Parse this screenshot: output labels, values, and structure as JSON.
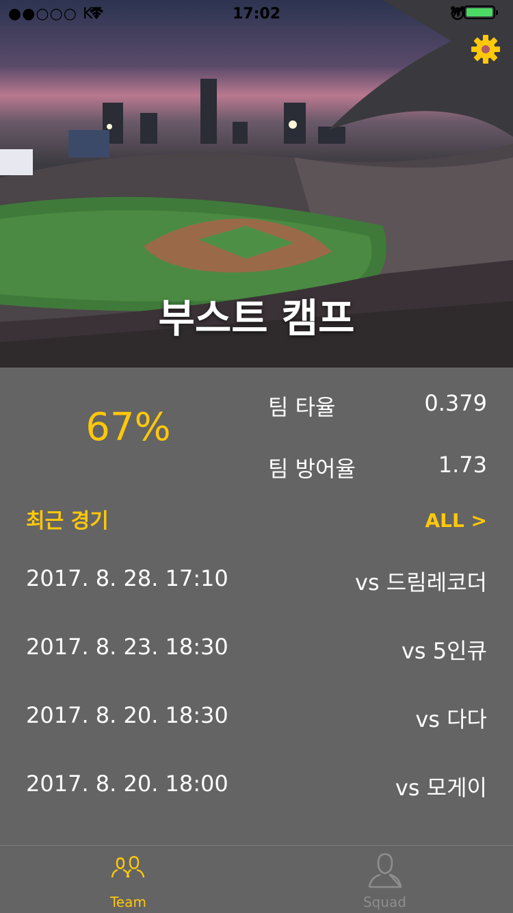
{
  "status_bar": {
    "carrier": "●●○○○ KT",
    "time": "17:02"
  },
  "hero": {
    "team_name": "부스트 캠프"
  },
  "stats": {
    "win_rate": "67%",
    "batting_avg_label": "팀 타율",
    "batting_avg_value": "0.379",
    "era_label": "팀 방어율",
    "era_value": "1.73"
  },
  "recent_games": {
    "title": "최근 경기",
    "all_label": "ALL >",
    "games": [
      {
        "date": "2017. 8. 28. 17:10",
        "opponent": "vs 드림레코더"
      },
      {
        "date": "2017. 8. 23. 18:30",
        "opponent": "vs 5인큐"
      },
      {
        "date": "2017. 8. 20. 18:30",
        "opponent": "vs 다다"
      },
      {
        "date": "2017. 8. 20. 18:00",
        "opponent": "vs 모게이"
      }
    ]
  },
  "tab_bar": {
    "tabs": [
      {
        "label": "Team",
        "icon": "team-icon",
        "selected": true
      },
      {
        "label": "Squad",
        "icon": "person-icon",
        "selected": false
      }
    ]
  },
  "colors": {
    "accent": "#ffc80a",
    "background": "#646464",
    "battery": "#4cd964",
    "inactive": "#8e8e8e"
  }
}
